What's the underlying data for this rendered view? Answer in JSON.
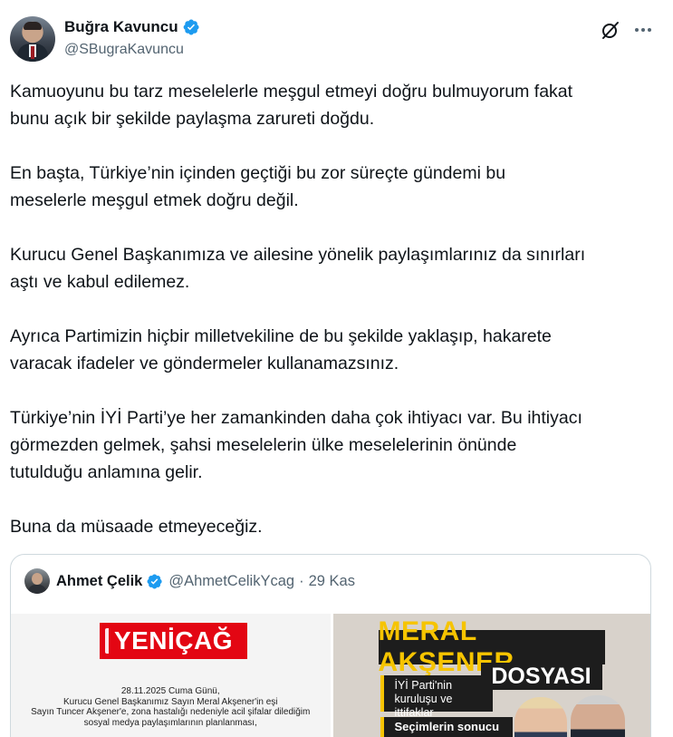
{
  "tweet": {
    "author": {
      "display_name": "Buğra Kavuncu",
      "handle": "@SBugraKavuncu",
      "verified": true
    },
    "icons": {
      "grok": "grok-icon",
      "more": "more-icon"
    },
    "paragraphs": [
      "Kamuoyunu bu tarz meselelerle meşgul etmeyi doğru bulmuyorum fakat\nbunu açık bir şekilde paylaşma zarureti doğdu.",
      "En başta, Türkiye’nin içinden geçtiği bu zor süreçte gündemi bu\nmeselerle meşgul etmek doğru değil.",
      "Kurucu Genel Başkanımıza ve ailesine yönelik paylaşımlarınız da sınırları\naştı ve kabul edilemez.",
      "Ayrıca Partimizin hiçbir milletvekiline de bu şekilde yaklaşıp, hakarete\nvaracak ifadeler ve göndermeler kullanamazsınız.",
      "Türkiye’nin İYİ Parti’ye her zamankinden daha çok ihtiyacı var. Bu ihtiyacı\ngörmezden gelmek, şahsi meselelerin ülke meselelerinin önünde\ntutulduğu anlamına gelir.",
      "Buna da müsaade etmeyeceğiz."
    ],
    "quote": {
      "display_name": "Ahmet Çelik",
      "handle": "@AhmetCelikYcag",
      "separator": "·",
      "date": "29 Kas",
      "verified": true,
      "media": {
        "left": {
          "logo_text": "YENİÇAĞ",
          "lines": [
            "28.11.2025 Cuma Günü,",
            "Kurucu Genel Başkanımız Sayın Meral Akşener'in eşi",
            "Sayın Tuncer Akşener'e, zona hastalığı nedeniyle acil şifalar dilediğim",
            "sosyal medya paylaşımlarının planlanması,"
          ]
        },
        "right": {
          "title": "MERAL AKŞENER",
          "subtitle": "DOSYASI",
          "item1": "İYİ Parti'nin kuruluşu ve ittifaklar",
          "item2": "Seçimlerin sonucu"
        }
      }
    },
    "colors": {
      "verified_blue": "#1d9bf0",
      "text_primary": "#0f1419",
      "text_secondary": "#536471",
      "border": "#cfd9de"
    }
  }
}
